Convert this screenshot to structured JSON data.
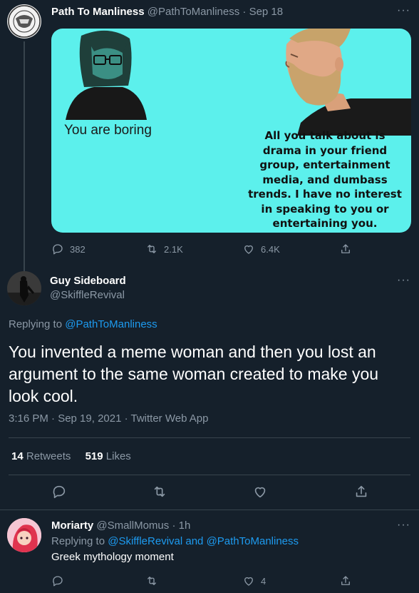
{
  "tweet1": {
    "display_name": "Path To Manliness",
    "handle": "@PathToManliness",
    "date": "Sep 18",
    "meme": {
      "left_text": "You are boring",
      "right_text": "All you talk about is drama in your friend group, entertainment media, and dumbass trends. I have no interest in speaking to you or entertaining you."
    },
    "actions": {
      "replies": "382",
      "retweets": "2.1K",
      "likes": "6.4K"
    }
  },
  "tweet2": {
    "display_name": "Guy Sideboard",
    "handle": "@SkiffleRevival",
    "replying_prefix": "Replying to",
    "replying_to": "@PathToManliness",
    "text": "You invented a meme woman and then you lost an argument to the same woman created to make you look cool.",
    "timestamp": "3:16 PM · Sep 19, 2021 · Twitter Web App",
    "retweets_count": "14",
    "retweets_label": "Retweets",
    "likes_count": "519",
    "likes_label": "Likes"
  },
  "tweet3": {
    "display_name": "Moriarty",
    "handle": "@SmallMomus",
    "time": "1h",
    "replying_prefix": "Replying to",
    "replying_to": "@SkiffleRevival and @PathToManliness",
    "text": "Greek mythology moment",
    "likes": "4"
  },
  "more_symbol": "···",
  "colors": {
    "background": "#15202b",
    "text": "#ffffff",
    "muted": "#8b98a5",
    "link": "#1d9bf0",
    "divider": "#38444d",
    "meme_bg": "#5cf0ec"
  },
  "icons": [
    "reply-icon",
    "retweet-icon",
    "like-icon",
    "share-icon",
    "more-icon"
  ]
}
